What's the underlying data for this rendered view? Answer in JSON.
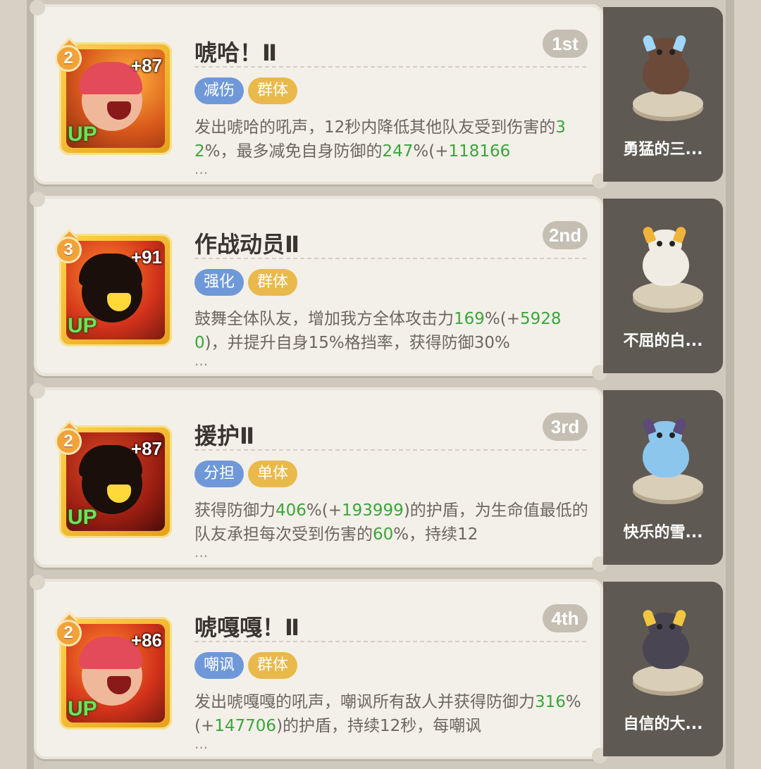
{
  "skills": [
    {
      "level": "2",
      "plus": "+87",
      "up": "UP",
      "title": "唬哈！Ⅱ",
      "rank": "1st",
      "tags": [
        {
          "label": "减伤",
          "color": "blue"
        },
        {
          "label": "群体",
          "color": "gold"
        }
      ],
      "desc": [
        {
          "t": "发出唬哈的吼声，12秒内降低其他队友受到伤害的",
          "g": false
        },
        {
          "t": "32",
          "g": true
        },
        {
          "t": "%，最多减免自身防御的",
          "g": false
        },
        {
          "t": "247",
          "g": true
        },
        {
          "t": "%(+",
          "g": false
        },
        {
          "t": "118166",
          "g": true
        }
      ],
      "more": "...",
      "pet": {
        "name": "勇猛的三...",
        "icon": "rhino-pet-icon"
      }
    },
    {
      "level": "3",
      "plus": "+91",
      "up": "UP",
      "title": "作战动员Ⅱ",
      "rank": "2nd",
      "tags": [
        {
          "label": "强化",
          "color": "blue"
        },
        {
          "label": "群体",
          "color": "gold"
        }
      ],
      "desc": [
        {
          "t": "鼓舞全体队友，增加我方全体攻击力",
          "g": false
        },
        {
          "t": "169",
          "g": true
        },
        {
          "t": "%(+",
          "g": false
        },
        {
          "t": "59280",
          "g": true
        },
        {
          "t": ")，并提升自身15%格挡率，获得防御30%",
          "g": false
        }
      ],
      "more": "...",
      "pet": {
        "name": "不屈的白...",
        "icon": "white-goat-pet-icon"
      }
    },
    {
      "level": "2",
      "plus": "+87",
      "up": "UP",
      "title": "援护Ⅱ",
      "rank": "3rd",
      "tags": [
        {
          "label": "分担",
          "color": "blue"
        },
        {
          "label": "单体",
          "color": "gold"
        }
      ],
      "desc": [
        {
          "t": "获得防御力",
          "g": false
        },
        {
          "t": "406",
          "g": true
        },
        {
          "t": "%(+",
          "g": false
        },
        {
          "t": "193999",
          "g": true
        },
        {
          "t": ")的护盾，为生命值最低的队友承担每次受到伤害的",
          "g": false
        },
        {
          "t": "60",
          "g": true
        },
        {
          "t": "%，持续12",
          "g": false
        }
      ],
      "more": "...",
      "pet": {
        "name": "快乐的雪...",
        "icon": "snow-creature-pet-icon"
      }
    },
    {
      "level": "2",
      "plus": "+86",
      "up": "UP",
      "title": "唬嘎嘎！Ⅱ",
      "rank": "4th",
      "tags": [
        {
          "label": "嘲讽",
          "color": "blue"
        },
        {
          "label": "群体",
          "color": "gold"
        }
      ],
      "desc": [
        {
          "t": "发出唬嘎嘎的吼声，嘲讽所有敌人并获得防御力",
          "g": false
        },
        {
          "t": "316",
          "g": true
        },
        {
          "t": "%(+",
          "g": false
        },
        {
          "t": "147706",
          "g": true
        },
        {
          "t": ")的护盾，持续12秒，每嘲讽",
          "g": false
        }
      ],
      "more": "...",
      "pet": {
        "name": "自信的大...",
        "icon": "dark-goat-pet-icon"
      }
    }
  ]
}
